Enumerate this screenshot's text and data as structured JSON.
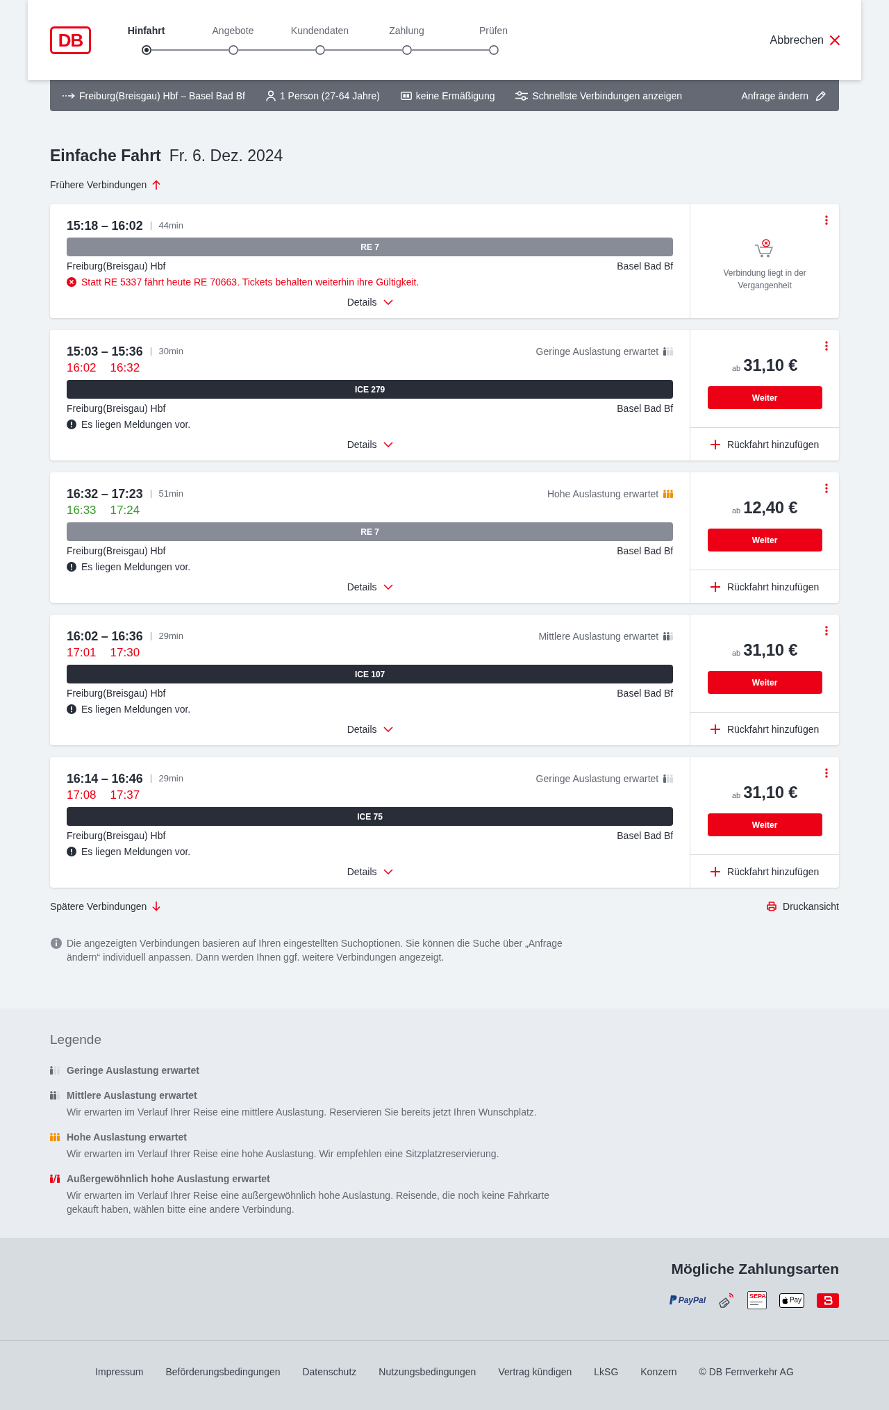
{
  "header": {
    "logo": "DB",
    "steps": [
      {
        "label": "Hinfahrt",
        "selected": true
      },
      {
        "label": "Angebote",
        "selected": false
      },
      {
        "label": "Kundendaten",
        "selected": false
      },
      {
        "label": "Zahlung",
        "selected": false
      },
      {
        "label": "Prüfen",
        "selected": false
      }
    ],
    "cancel": "Abbrechen"
  },
  "search_summary": {
    "route": "Freiburg(Breisgau) Hbf – Basel Bad Bf",
    "passengers": "1 Person (27-64 Jahre)",
    "discount": "keine Ermäßigung",
    "option": "Schnellste Verbindungen anzeigen",
    "edit": "Anfrage ändern"
  },
  "heading": {
    "title": "Einfache Fahrt",
    "date": "Fr. 6. Dez. 2024"
  },
  "earlier_link": "Frühere Verbindungen",
  "connections": [
    {
      "kind": "past",
      "times": "15:18 – 16:02",
      "duration": "44min",
      "train": {
        "kind": "regional",
        "name": "RE 7"
      },
      "origin": "Freiburg(Breisgau) Hbf",
      "destination": "Basel Bad Bf",
      "message": {
        "kind": "error",
        "text": "Statt RE 5337 fährt heute RE 70663. Tickets behalten weiterhin ihre Gültigkeit."
      },
      "details": "Details",
      "note": "Verbindung liegt in der Vergangenheit"
    },
    {
      "kind": "bookable",
      "times": "15:03 – 15:36",
      "duration": "30min",
      "occupancy": {
        "kind": "low",
        "label": "Geringe Auslastung erwartet"
      },
      "realtime": {
        "departure": "16:02",
        "arrival": "16:32",
        "delayed": true
      },
      "train": {
        "kind": "long_distance",
        "name": "ICE 279"
      },
      "origin": "Freiburg(Breisgau) Hbf",
      "destination": "Basel Bad Bf",
      "message": {
        "kind": "info",
        "text": "Es liegen Meldungen vor."
      },
      "details": "Details",
      "offer": {
        "prefix": "ab",
        "price": "31,10 €",
        "button": "Weiter",
        "return_trip": "Rückfahrt hinzufügen"
      }
    },
    {
      "kind": "bookable",
      "times": "16:32 – 17:23",
      "duration": "51min",
      "occupancy": {
        "kind": "high",
        "label": "Hohe Auslastung erwartet"
      },
      "realtime": {
        "departure": "16:33",
        "arrival": "17:24",
        "delayed": false
      },
      "train": {
        "kind": "regional",
        "name": "RE 7"
      },
      "origin": "Freiburg(Breisgau) Hbf",
      "destination": "Basel Bad Bf",
      "message": {
        "kind": "info",
        "text": "Es liegen Meldungen vor."
      },
      "details": "Details",
      "offer": {
        "prefix": "ab",
        "price": "12,40 €",
        "button": "Weiter",
        "return_trip": "Rückfahrt hinzufügen"
      }
    },
    {
      "kind": "bookable",
      "times": "16:02 – 16:36",
      "duration": "29min",
      "occupancy": {
        "kind": "medium",
        "label": "Mittlere Auslastung erwartet"
      },
      "realtime": {
        "departure": "17:01",
        "arrival": "17:30",
        "delayed": true
      },
      "train": {
        "kind": "long_distance",
        "name": "ICE 107"
      },
      "origin": "Freiburg(Breisgau) Hbf",
      "destination": "Basel Bad Bf",
      "message": {
        "kind": "info",
        "text": "Es liegen Meldungen vor."
      },
      "details": "Details",
      "offer": {
        "prefix": "ab",
        "price": "31,10 €",
        "button": "Weiter",
        "return_trip": "Rückfahrt hinzufügen"
      }
    },
    {
      "kind": "bookable",
      "times": "16:14 – 16:46",
      "duration": "29min",
      "occupancy": {
        "kind": "low",
        "label": "Geringe Auslastung erwartet"
      },
      "realtime": {
        "departure": "17:08",
        "arrival": "17:37",
        "delayed": true
      },
      "train": {
        "kind": "long_distance",
        "name": "ICE 75"
      },
      "origin": "Freiburg(Breisgau) Hbf",
      "destination": "Basel Bad Bf",
      "message": {
        "kind": "info",
        "text": "Es liegen Meldungen vor."
      },
      "details": "Details",
      "offer": {
        "prefix": "ab",
        "price": "31,10 €",
        "button": "Weiter",
        "return_trip": "Rückfahrt hinzufügen"
      }
    }
  ],
  "later_link": "Spätere Verbindungen",
  "print_link": "Druckansicht",
  "info_note": "Die angezeigten Verbindungen basieren auf Ihren eingestellten Suchoptionen. Sie können die Suche über „Anfrage ändern“ individuell anpassen. Dann werden Ihnen ggf. weitere Verbindungen angezeigt.",
  "legend": {
    "title": "Legende",
    "items": [
      {
        "kind": "low",
        "title": "Geringe Auslastung erwartet"
      },
      {
        "kind": "medium",
        "title": "Mittlere Auslastung erwartet",
        "text": "Wir erwarten im Verlauf Ihrer Reise eine mittlere Auslastung. Reservieren Sie bereits jetzt Ihren Wunschplatz."
      },
      {
        "kind": "high",
        "title": "Hohe Auslastung erwartet",
        "text": "Wir erwarten im Verlauf Ihrer Reise eine hohe Auslastung. Wir empfehlen eine Sitzplatzreservierung."
      },
      {
        "kind": "extreme",
        "title": "Außergewöhnlich hohe Auslastung erwartet",
        "text": "Wir erwarten im Verlauf Ihrer Reise eine außergewöhnlich hohe Auslastung. Reisende, die noch keine Fahrkarte gekauft haben, wählen bitte eine andere Verbindung."
      }
    ]
  },
  "payment": {
    "title": "Mögliche Zahlungsarten",
    "methods": [
      {
        "kind": "paypal",
        "label": "PayPal"
      },
      {
        "kind": "contactless"
      },
      {
        "kind": "sepa",
        "label": "SEPA"
      },
      {
        "kind": "applepay",
        "label": "Pay"
      },
      {
        "kind": "app"
      }
    ]
  },
  "footer_links": [
    "Impressum",
    "Beförderungsbedingungen",
    "Datenschutz",
    "Nutzungsbedingungen",
    "Vertrag kündigen",
    "LkSG",
    "Konzern",
    "© DB Fernverkehr AG"
  ]
}
